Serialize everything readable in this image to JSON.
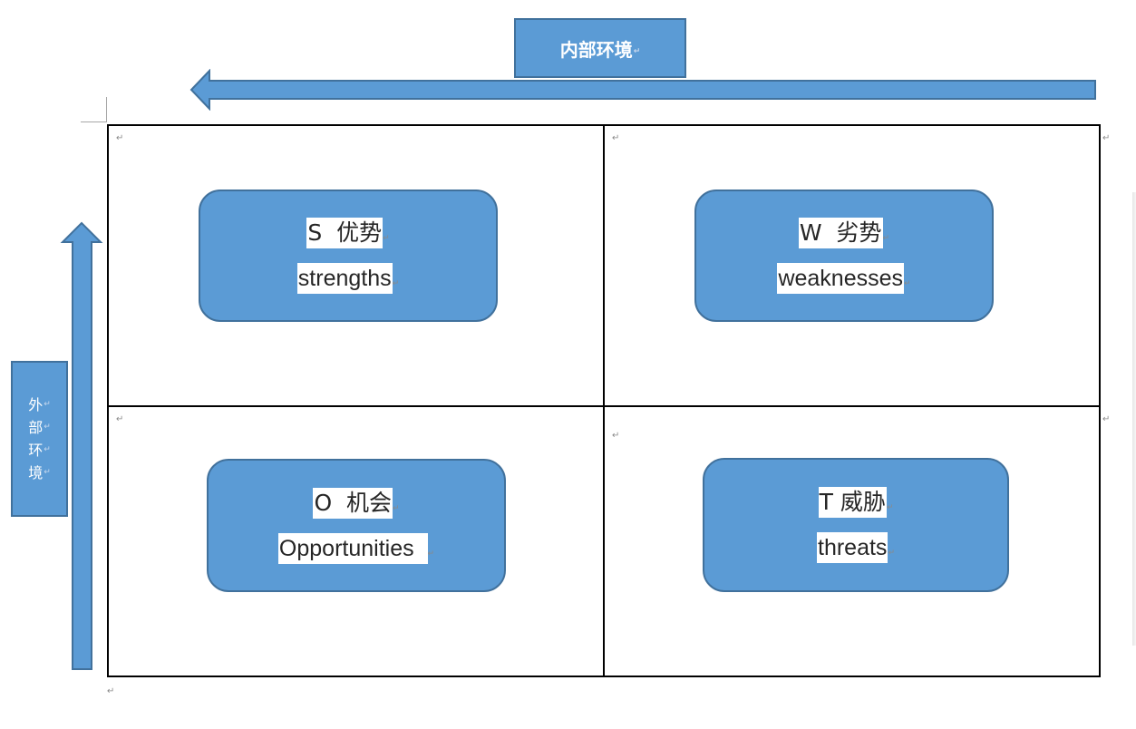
{
  "document": {
    "paragraph_mark": "↵"
  },
  "axes": {
    "internal": {
      "label": "内部环境",
      "arrow_direction": "left"
    },
    "external": {
      "label_chars": [
        "外",
        "部",
        "环",
        "境"
      ],
      "arrow_direction": "up"
    }
  },
  "quadrants": [
    {
      "id": "S",
      "title": "S  优势",
      "subtitle": "strengths"
    },
    {
      "id": "W",
      "title": "W  劣势",
      "subtitle": "weaknesses"
    },
    {
      "id": "O",
      "title": "O  机会",
      "subtitle": "Opportunities  "
    },
    {
      "id": "T",
      "title": "T 威胁",
      "subtitle": "threats"
    }
  ],
  "colors": {
    "shape_fill": "#5b9bd5",
    "shape_border": "#41719c",
    "grid_line": "#000000",
    "text": "#262626"
  }
}
